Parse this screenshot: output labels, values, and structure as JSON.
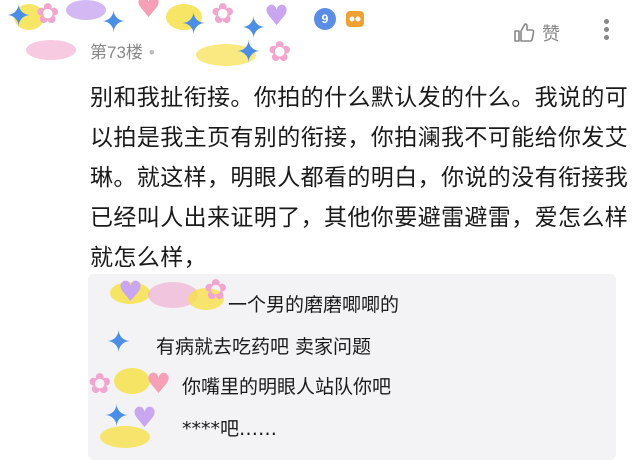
{
  "comment": {
    "floor_label": "第73楼",
    "level_badge": "9",
    "like_label": "赞",
    "body": "别和我扯衔接。你拍的什么默认发的什么。我说的可以拍是我主页有别的衔接，你拍澜我不可能给你发艾琳。就这样，明眼人都看的明白，你说的没有衔接我已经叫人出来证明了，其他你要避雷避雷，爱怎么样就怎么样，"
  },
  "replies": [
    {
      "text": "一个男的磨磨唧唧的"
    },
    {
      "text": "有病就去吃药吧 卖家问题"
    },
    {
      "text": "你嘴里的明眼人站队你吧"
    },
    {
      "text": "****吧……"
    }
  ],
  "colors": {
    "sparkle_blue": "#4a8ee8",
    "pink": "#f1a6cf",
    "purple": "#c9a6f0",
    "yellow": "#f6e04a",
    "meta_gray": "#888888",
    "reply_bg": "#f3f3f5"
  },
  "icons": [
    "sparkle-icon",
    "heart-icon",
    "flower-icon",
    "level-badge",
    "game-controller-icon",
    "thumbs-up-icon",
    "more-vertical-icon"
  ]
}
